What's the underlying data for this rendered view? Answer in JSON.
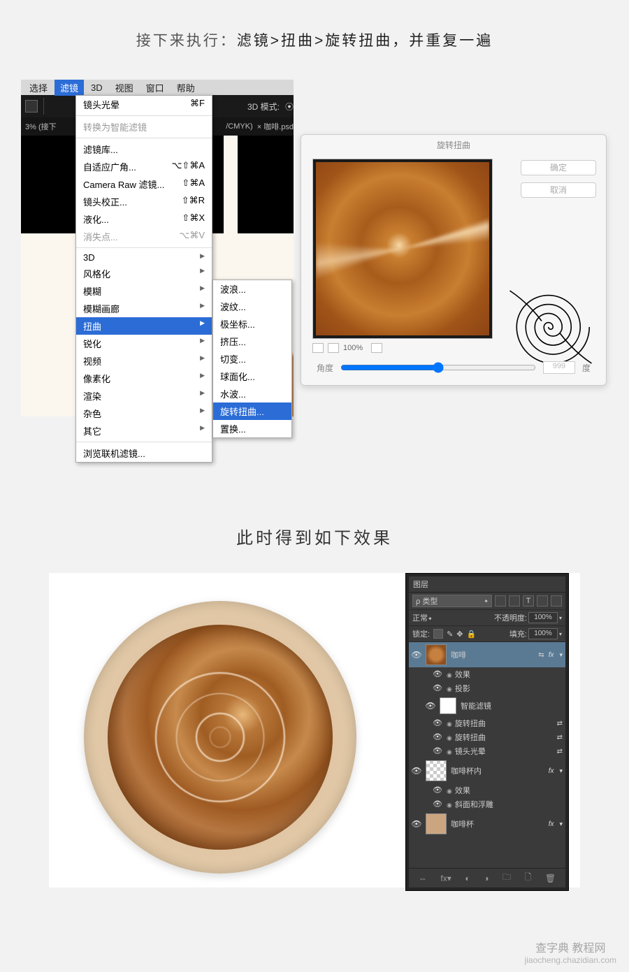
{
  "caption1_prefix": "接下来执行：",
  "caption1_main": "滤镜>扭曲>旋转扭曲，并重复一遍",
  "caption2": "此时得到如下效果",
  "menubar": {
    "select": "选择",
    "filter": "滤镜",
    "threeD": "3D",
    "view": "视图",
    "window": "窗口",
    "help": "帮助"
  },
  "toolrow": {
    "modeHint": "3D 模式:"
  },
  "tabrow": {
    "percent": "3% (接下",
    "cmyk": "/CMYK)",
    "tab2": "× 咖啡.psd"
  },
  "filterMenu": {
    "last": "镜头光晕",
    "lastKey": "⌘F",
    "smart": "转换为智能滤镜",
    "gallery": "滤镜库...",
    "adaptive": "自适应广角...",
    "adaptiveKey": "⌥⇧⌘A",
    "cameraRaw": "Camera Raw 滤镜...",
    "cameraRawKey": "⇧⌘A",
    "lensCorr": "镜头校正...",
    "lensCorrKey": "⇧⌘R",
    "liquify": "液化...",
    "liquifyKey": "⇧⌘X",
    "vanish": "消失点...",
    "vanishKey": "⌥⌘V",
    "g3d": "3D",
    "stylize": "风格化",
    "blur": "模糊",
    "blurGal": "模糊画廊",
    "distort": "扭曲",
    "sharpen": "锐化",
    "video": "视频",
    "pixelate": "像素化",
    "render": "渲染",
    "noise": "杂色",
    "other": "其它",
    "browse": "浏览联机滤镜..."
  },
  "distortSub": {
    "wave": "波浪...",
    "ripple": "波纹...",
    "polar": "极坐标...",
    "pinch": "挤压...",
    "shear": "切变...",
    "spherize": "球面化...",
    "zigzag": "水波...",
    "twirl": "旋转扭曲...",
    "displace": "置换..."
  },
  "twirlDialog": {
    "title": "旋转扭曲",
    "ok": "确定",
    "cancel": "取消",
    "zoom": "100%",
    "angle": "角度",
    "angleVal": "999",
    "deg": "度"
  },
  "layersPanel": {
    "tab": "图层",
    "kind": "ρ 类型",
    "blend": "正常",
    "opacityLbl": "不透明度:",
    "opacity": "100%",
    "lockLbl": "锁定:",
    "fillLbl": "填充:",
    "fill": "100%",
    "layers": {
      "coffee": "咖啡",
      "effects": "效果",
      "dropShadow": "投影",
      "smartFilters": "智能滤镜",
      "twirl1": "旋转扭曲",
      "twirl2": "旋转扭曲",
      "lensFlare": "镜头光晕",
      "cupInside": "咖啡杯内",
      "bevel": "斜面和浮雕",
      "cup": "咖啡杯"
    },
    "fx": "fx"
  },
  "watermark": {
    "line1": "查字典 教程网",
    "line2": "jiaocheng.chazidian.com"
  }
}
